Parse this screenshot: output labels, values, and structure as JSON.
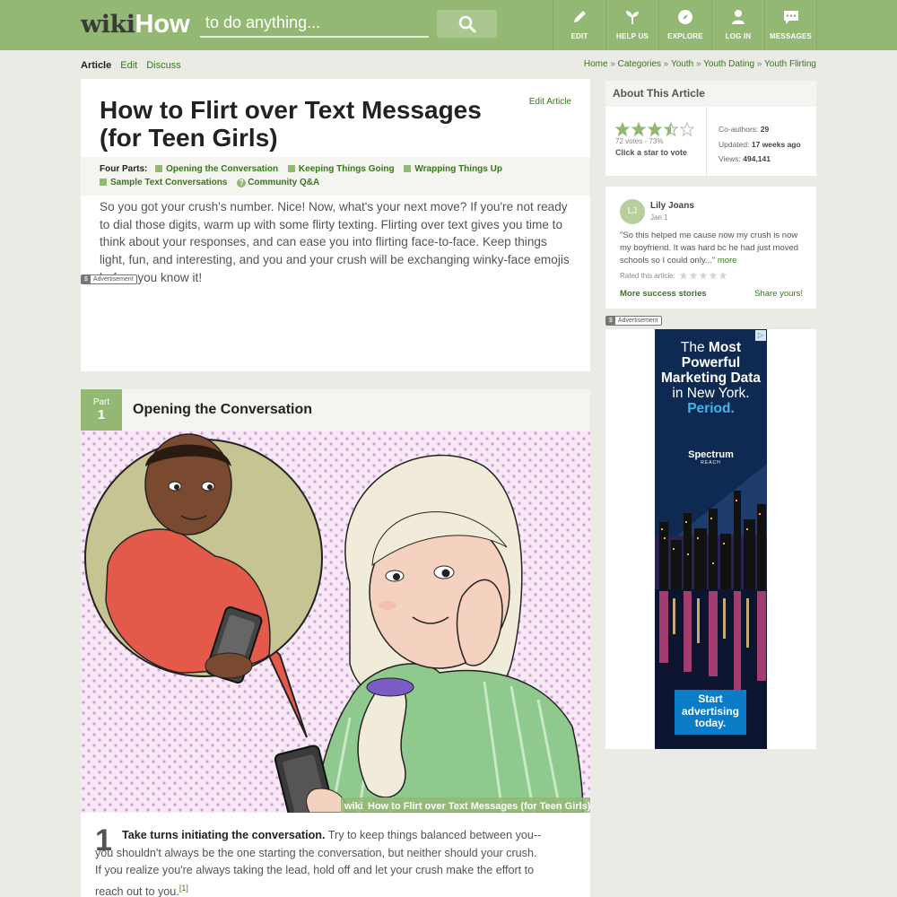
{
  "header": {
    "logo_part1": "wiki",
    "logo_part2": "How",
    "search_placeholder": "to do anything...",
    "nav": [
      {
        "label": "EDIT",
        "icon": "pencil-icon"
      },
      {
        "label": "HELP US",
        "icon": "sprout-icon"
      },
      {
        "label": "EXPLORE",
        "icon": "compass-icon"
      },
      {
        "label": "LOG IN",
        "icon": "user-icon"
      },
      {
        "label": "MESSAGES",
        "icon": "chat-icon"
      }
    ]
  },
  "tabs": {
    "article": "Article",
    "edit": "Edit",
    "discuss": "Discuss"
  },
  "breadcrumb": [
    "Home",
    "Categories",
    "Youth",
    "Youth Dating",
    "Youth Flirting"
  ],
  "breadcrumb_sep": "»",
  "article": {
    "title": "How to Flirt over Text Messages (for Teen Girls)",
    "edit_label": "Edit Article",
    "parts_lead": "Four Parts:",
    "parts": [
      "Opening the Conversation",
      "Keeping Things Going",
      "Wrapping Things Up",
      "Sample Text Conversations"
    ],
    "qa_label": "Community Q&A",
    "intro": "So you got your crush's number. Nice! Now, what's your next move? If you're not ready to dial those digits, warm up with some flirty texting. Flirting over text gives you time to think about your responses, and can ease you into flirting face-to-face. Keep things light, fun, and interesting, and you and your crush will be exchanging winky-face emojis before you know it!",
    "ad_label": "Advertisement",
    "ad_symbol": "$"
  },
  "part1": {
    "badge_word": "Part",
    "badge_number": "1",
    "title": "Opening the Conversation",
    "image_caption": "How to Flirt over Text Messages (for Teen Girls)",
    "image_watermark": "wiki",
    "step_number": "1",
    "step_bold": "Take turns initiating the conversation.",
    "step_text": " Try to keep things balanced between you--you shouldn't always be the one starting the conversation, but neither should your crush. If you realize you're always taking the lead, hold off and let your crush make the effort to reach out to you.",
    "step_ref": "[1]"
  },
  "about": {
    "heading": "About This Article",
    "rating": 3.5,
    "rating_max": 5,
    "votes": "72 votes - 73%",
    "vote_cta": "Click a star to vote",
    "coauthors_label": "Co-authors:",
    "coauthors": "29",
    "updated_label": "Updated:",
    "updated": "17 weeks ago",
    "views_label": "Views:",
    "views": "494,141"
  },
  "story": {
    "initials": "LJ",
    "author": "Lily Joans",
    "date": "Jan 1",
    "quote": "\"So this helped me cause now my crush is now my boyfriend. It was hard bc he had just moved schools so I could only...\"",
    "more": "more",
    "rated_label": "Rated this article:",
    "more_stories": "More success stories",
    "share": "Share yours!"
  },
  "side_ad": {
    "label": "Advertisement",
    "symbol": "$",
    "line1": "The",
    "line1b": "Most",
    "line2": "Powerful Marketing Data",
    "line3": "in New York.",
    "line4": "Period.",
    "brand": "Spectrum",
    "brand_sub": "REACH",
    "cta": "Start advertising today."
  },
  "colors": {
    "brand_green": "#93b874",
    "link_green": "#38761d",
    "background": "#ebebe5"
  }
}
